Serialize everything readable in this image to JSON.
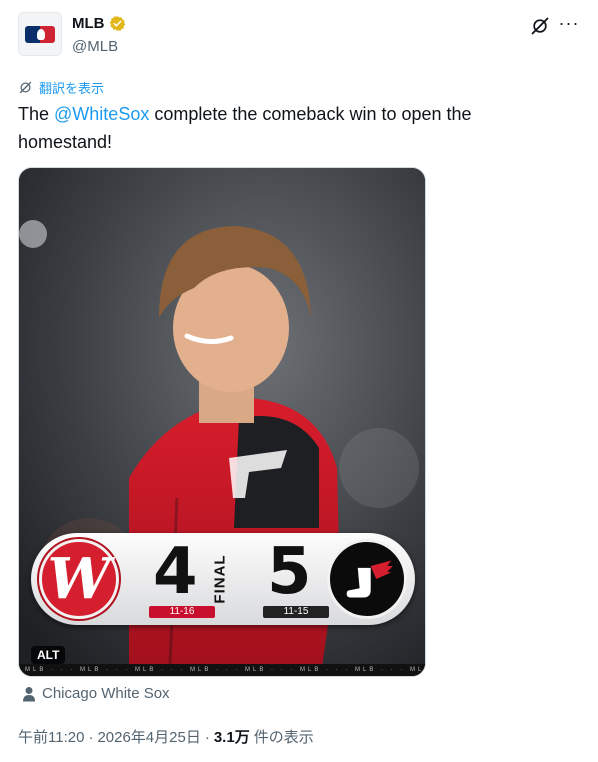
{
  "author": {
    "display_name": "MLB",
    "handle": "@MLB",
    "avatar_icon": "mlb-logo-icon",
    "verified_icon": "gold-verified-badge-icon"
  },
  "header_actions": {
    "grok_icon": "grok-icon",
    "more_icon": "more-icon",
    "more_glyph": "···"
  },
  "translate": {
    "label": "翻訳を表示",
    "icon": "translate-icon"
  },
  "tweet": {
    "text_before": "The ",
    "mention": "@WhiteSox",
    "text_after": " complete the comeback win to open the homestand!"
  },
  "media": {
    "alt_badge": "ALT",
    "scoreboard": {
      "home_team_logo_letter": "W",
      "home_score": "4",
      "away_score": "5",
      "status": "FINAL",
      "home_record": "11-16",
      "away_record": "11-15"
    },
    "ticker_text": "MLB · · · MLB · · · MLB · · · MLB · · · MLB · · · MLB · · · MLB · · · MLB"
  },
  "location": {
    "label": "Chicago White Sox",
    "icon": "location-pin-icon"
  },
  "meta": {
    "time": "午前11:20",
    "separator": "·",
    "date": "2026年4月25日",
    "views_count": "3.1万",
    "views_label": "件の表示"
  },
  "colors": {
    "link": "#1d9bf0",
    "secondary_text": "#536471",
    "nationals_red": "#c8102e",
    "verified_gold": "#e2b719"
  }
}
